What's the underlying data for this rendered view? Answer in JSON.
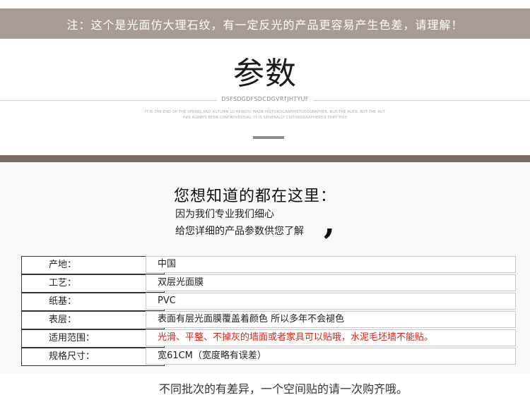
{
  "notice": "注：这个是光面仿大理石纹，有一定反光的产品更容易产生色差，请理解！",
  "params": {
    "title": "参数",
    "subtitle": "DSFSDGDFSDCDGVRTJHTYUF",
    "desc_line1": "IT IS THE END OF THE SPRING AND AUTUMN LU HENGYU MADE HISTOROGRAPHISTOROGRAPHER. BUT THE AUER. BUT THE AUT",
    "desc_line2": "HAS ALWAYS BEEN CONTROVERSIAL. IT IS GENERALLY CISTOROGRAPHERED THAT THIS"
  },
  "intro": {
    "heading": "您想知道的都在这里：",
    "line1": "因为我们专业我们细心",
    "line2": "给您详细的产品参数供您了解"
  },
  "specs": [
    {
      "label": "产地：",
      "value": "中国"
    },
    {
      "label": "工艺：",
      "value": "双层光面膜"
    },
    {
      "label": "纸基：",
      "value": "PVC"
    },
    {
      "label": "表层：",
      "value": "表面有层光面膜覆盖着颜色 所以多年不会褪色"
    },
    {
      "label": "适用范围：",
      "value": "光滑、平整、不掉灰的墙面或者家具可以贴哦，水泥毛坯墙不能贴。"
    },
    {
      "label": "规格尺寸：",
      "value": "宽61CM（宽度略有误差）"
    }
  ],
  "footer": "不同批次的有差异，一个空间贴的请一次购齐哦。",
  "colors": {
    "notice_bg": "#a89b93",
    "band": "#7a6a62",
    "highlight": "#d8251b"
  }
}
